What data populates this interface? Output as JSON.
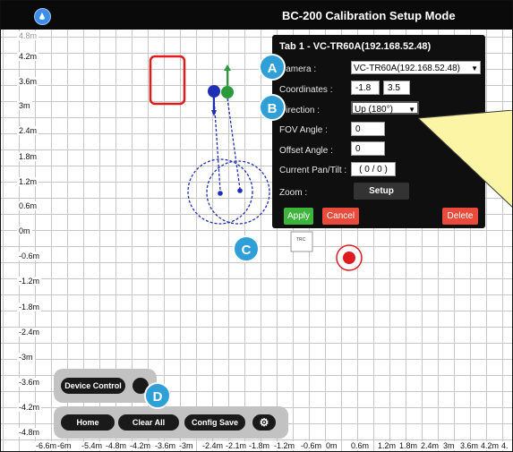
{
  "window": {
    "title": "BC-200 Calibration Setup Mode"
  },
  "grid": {
    "y_labels": [
      "4.2m",
      "3.6m",
      "3m",
      "2.4m",
      "1.8m",
      "1.2m",
      "0.6m",
      "0m",
      "-0.6m",
      "-1.2m",
      "-1.8m",
      "-2.4m",
      "-3m",
      "-3.6m",
      "-4.2m",
      "-4.8m"
    ],
    "y_label_top_cut": "4.8m",
    "x_labels": [
      "-6.6m",
      "-6m",
      "-5.4m",
      "-4.8m",
      "-4.2m",
      "-3.6m",
      "-3m",
      "-2.4m",
      "-2.1m",
      "-1.8m",
      "-1.2m",
      "-0.6m",
      "0m",
      "0.6m",
      "1.2m",
      "1.8m",
      "2.4m",
      "3m",
      "3.6m",
      "4.2m",
      "4."
    ]
  },
  "panel": {
    "title": "Tab 1 - VC-TR60A(192.168.52.48)",
    "camera_label": "Camera :",
    "camera_value": "VC-TR60A(192.168.52.48)",
    "coordinates_label": "Coordinates :",
    "coord_x": "-1.8",
    "coord_y": "3.5",
    "direction_label": "Direction :",
    "direction_value": "Up (180°)",
    "fov_label": "FOV Angle :",
    "fov_value": "0",
    "offset_label": "Offset Angle :",
    "offset_value": "0",
    "pantilt_label": "Current Pan/Tilt :",
    "pantilt_value": "( 0 / 0 )",
    "zoom_label": "Zoom :",
    "setup_label": "Setup",
    "apply_label": "Apply",
    "cancel_label": "Cancel",
    "delete_label": "Delete"
  },
  "markers": {
    "a": "A",
    "b": "B",
    "c": "C",
    "d": "D"
  },
  "device_tag": "TRC",
  "toolbar": {
    "device_control": "Device Control",
    "home": "Home",
    "clear_all": "Clear All",
    "config_save": "Config Save"
  },
  "icons": {
    "logo": "app-logo-icon",
    "settings": "gear-icon",
    "target": "target-icon"
  },
  "colors": {
    "marker": "#2f9fd8",
    "apply": "#3db53d",
    "cancel": "#e84b3c",
    "zone": "#e01b1b",
    "camera_path": "#1f2fb3",
    "callout": "#fdf5a6"
  }
}
